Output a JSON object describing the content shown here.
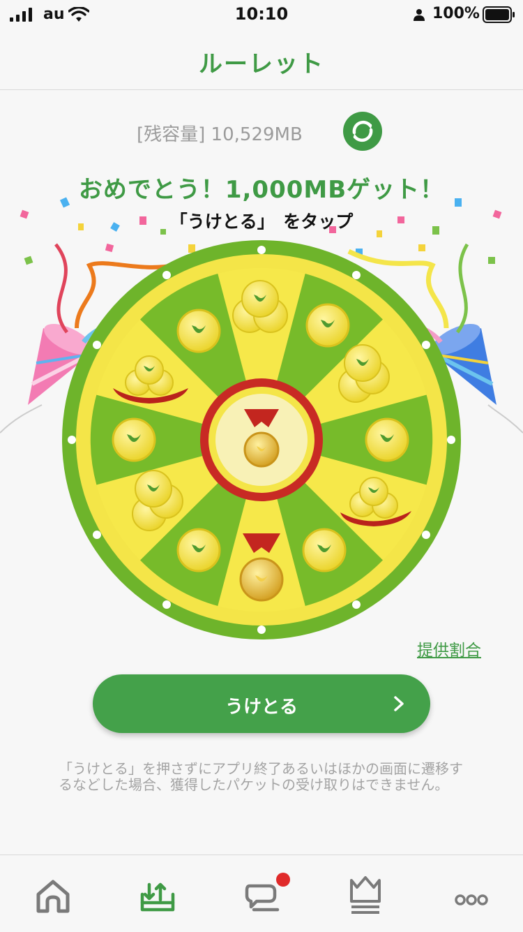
{
  "status_bar": {
    "carrier": "au",
    "time": "10:10",
    "battery": "100%"
  },
  "header": {
    "title": "ルーレット"
  },
  "remaining": "[残容量] 10,529MB",
  "congrats": "おめでとう！1,000MBゲット！",
  "instruction": "「うけとる」　をタップ",
  "rates_link": "提供割合",
  "receive_button": "うけとる",
  "note": "「うけとる」を押さずにアプリ終了あるいはほかの画面に遷移するなどした場合、獲得したパケットの受け取りはできません。",
  "colors": {
    "brand_green": "#3f9a45",
    "button_green": "#44a14a",
    "wheel_yellow": "#f6e84a",
    "wheel_green": "#77bb2a",
    "badge_red": "#e02a2a"
  },
  "icons": {
    "signal": "signal-bars-icon",
    "wifi": "wifi-icon",
    "person": "person-icon",
    "battery": "battery-icon",
    "refresh": "refresh-icon",
    "chevron": "chevron-right-icon",
    "tabs": [
      "home-icon",
      "gift-download-icon",
      "chat-icon",
      "crown-icon",
      "more-icon"
    ]
  }
}
